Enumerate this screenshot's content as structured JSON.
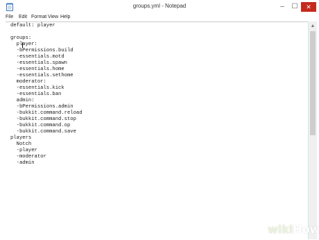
{
  "window": {
    "title": "groups.yml - Notepad",
    "controls": {
      "minimize": "–",
      "maximize": "☐",
      "close": "✕"
    }
  },
  "menu": [
    "File",
    "Edit",
    "Format",
    "View",
    "Help"
  ],
  "editor": {
    "lines": [
      "default: player",
      "",
      "groups:",
      "  player:",
      "  -bPermissions.build",
      "  -essentials.motd",
      "  -essentials.spawn",
      "  -essentials.home",
      "  -essentials.sethome",
      "  moderator:",
      "  -essentials.kick",
      "  -essentials.ban",
      "  admin:",
      "  -bPermissions.admin",
      "  -bukkit.command.reload",
      "  -bukkit.command.stop",
      "  -bukkit.command.op",
      "  -bukkit.command.save",
      "players",
      "  Notch",
      "  -player",
      "  -moderator",
      "  -admin"
    ]
  },
  "watermark": {
    "part1": "wiki",
    "part2": "How"
  },
  "colors": {
    "close_button": "#c42b1c",
    "text": "#1a1a1a"
  }
}
